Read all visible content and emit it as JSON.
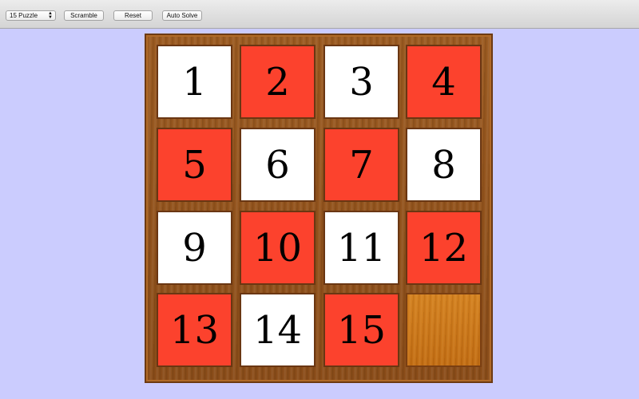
{
  "toolbar": {
    "puzzle_select_value": "15 Puzzle",
    "scramble_label": "Scramble",
    "reset_label": "Reset",
    "auto_solve_label": "Auto Solve"
  },
  "board": {
    "rows": 4,
    "cols": 4,
    "tiles": [
      {
        "label": "1",
        "color": "white"
      },
      {
        "label": "2",
        "color": "red"
      },
      {
        "label": "3",
        "color": "white"
      },
      {
        "label": "4",
        "color": "red"
      },
      {
        "label": "5",
        "color": "red"
      },
      {
        "label": "6",
        "color": "white"
      },
      {
        "label": "7",
        "color": "red"
      },
      {
        "label": "8",
        "color": "white"
      },
      {
        "label": "9",
        "color": "white"
      },
      {
        "label": "10",
        "color": "red"
      },
      {
        "label": "11",
        "color": "white"
      },
      {
        "label": "12",
        "color": "red"
      },
      {
        "label": "13",
        "color": "red"
      },
      {
        "label": "14",
        "color": "white"
      },
      {
        "label": "15",
        "color": "red"
      },
      {
        "label": "",
        "color": "empty"
      }
    ]
  },
  "colors": {
    "background": "#cbccfe",
    "tile_red": "#fc422d",
    "tile_white": "#ffffff",
    "frame_wood": "#8a4c18"
  }
}
